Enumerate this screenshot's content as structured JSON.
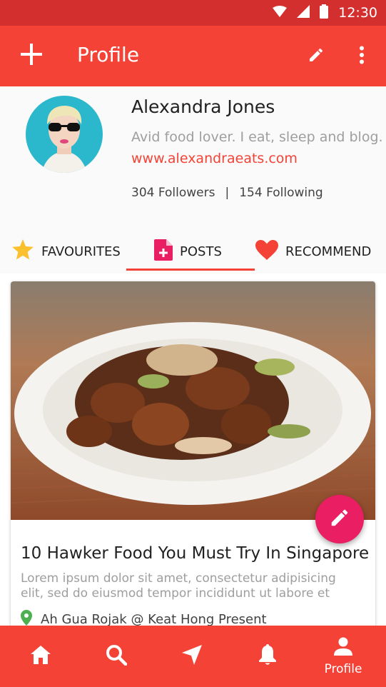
{
  "status_bar": {
    "time": "12:30",
    "icons": [
      "wifi-icon",
      "signal-icon",
      "battery-icon"
    ]
  },
  "app_bar": {
    "title": "Profile",
    "left_icon": "add-icon",
    "right_icons": [
      "edit-icon",
      "more-vert-icon"
    ]
  },
  "profile": {
    "name": "Alexandra Jones",
    "bio": "Avid food lover. I eat, sleep and blog.",
    "website": "www.alexandraeats.com",
    "followers": "304 Followers",
    "separator": "|",
    "following": "154 Following"
  },
  "tabs": [
    {
      "label": "FAVOURITES",
      "icon": "star-icon",
      "active": false
    },
    {
      "label": "POSTS",
      "icon": "post-add-icon",
      "active": true
    },
    {
      "label": "RECOMMEND",
      "icon": "heart-icon",
      "active": false
    }
  ],
  "post": {
    "title": "10 Hawker Food You Must Try In Singapore",
    "description": "Lorem ipsum dolor sit amet, consectetur adipisicing elit, sed do eiusmod tempor incididunt ut labore et",
    "location": "Ah Gua Rojak @ Keat Hong Present",
    "image": "food-plate-image"
  },
  "fab": {
    "icon": "edit-icon"
  },
  "bottom_nav": [
    {
      "icon": "home-icon",
      "label": ""
    },
    {
      "icon": "search-icon",
      "label": ""
    },
    {
      "icon": "navigation-icon",
      "label": ""
    },
    {
      "icon": "notifications-icon",
      "label": ""
    },
    {
      "icon": "person-icon",
      "label": "Profile"
    }
  ],
  "colors": {
    "primary": "#f44336",
    "primary_dark": "#d32f2f",
    "accent": "#e91e63",
    "star": "#fbc02d",
    "location_pin": "#4caf50"
  }
}
